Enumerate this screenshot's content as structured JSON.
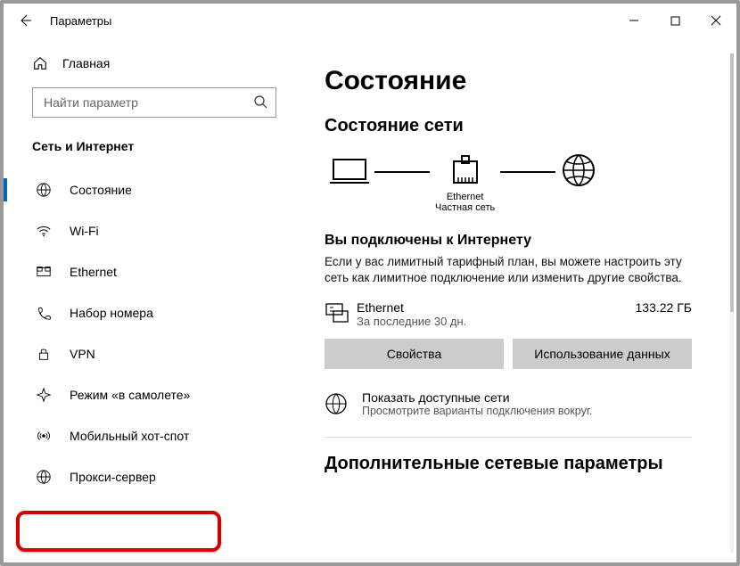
{
  "window": {
    "title": "Параметры"
  },
  "sidebar": {
    "home": "Главная",
    "search_placeholder": "Найти параметр",
    "category": "Сеть и Интернет",
    "items": [
      {
        "label": "Состояние"
      },
      {
        "label": "Wi-Fi"
      },
      {
        "label": "Ethernet"
      },
      {
        "label": "Набор номера"
      },
      {
        "label": "VPN"
      },
      {
        "label": "Режим «в самолете»"
      },
      {
        "label": "Мобильный хот-спот"
      },
      {
        "label": "Прокси-сервер"
      }
    ]
  },
  "main": {
    "title": "Состояние",
    "subtitle": "Состояние сети",
    "diagram": {
      "label1": "Ethernet",
      "label2": "Частная сеть"
    },
    "status_heading": "Вы подключены к Интернету",
    "status_desc": "Если у вас лимитный тарифный план, вы можете настроить эту сеть как лимитное подключение или изменить другие свойства.",
    "usage": {
      "name": "Ethernet",
      "period": "За последние 30 дн.",
      "amount": "133.22 ГБ"
    },
    "btn_props": "Свойства",
    "btn_usage": "Использование данных",
    "available": {
      "title": "Показать доступные сети",
      "desc": "Просмотрите варианты подключения вокруг."
    },
    "additional": "Дополнительные сетевые параметры"
  }
}
